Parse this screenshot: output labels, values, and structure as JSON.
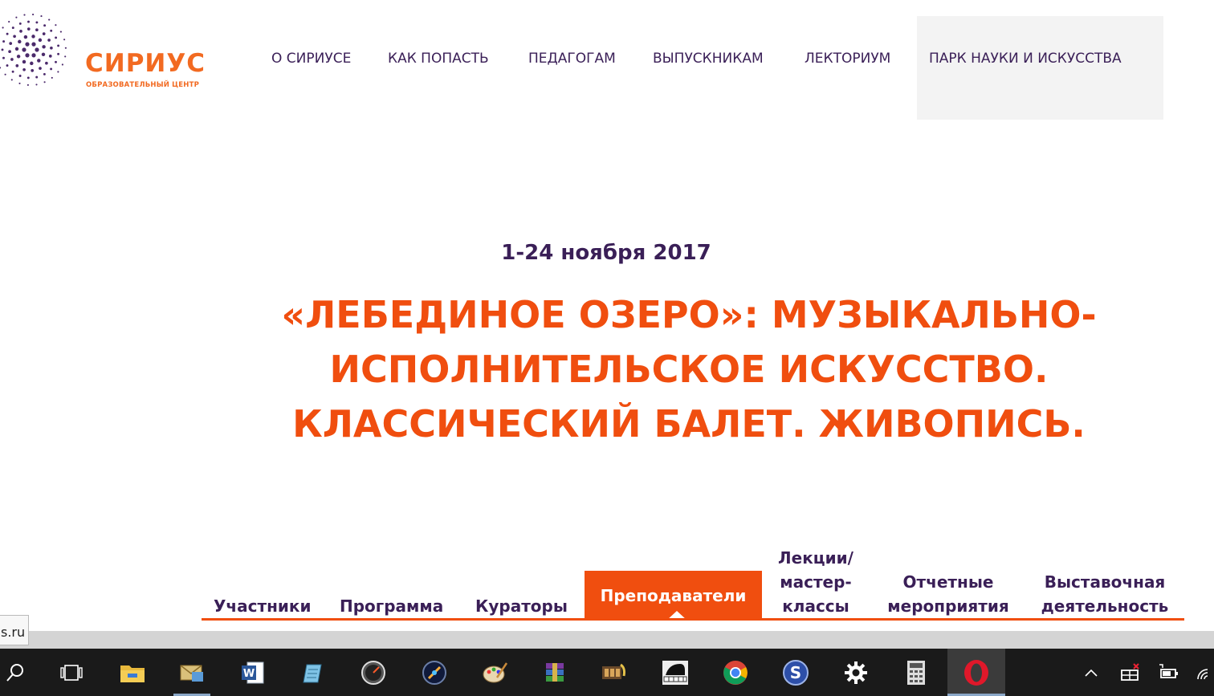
{
  "logo": {
    "name": "СИРИУС",
    "subtitle": "ОБРАЗОВАТЕЛЬНЫЙ ЦЕНТР",
    "color": "#f26a21",
    "dot_color": "#4b2a6b"
  },
  "nav": {
    "items": [
      {
        "label": "О СИРИУСЕ"
      },
      {
        "label": "КАК ПОПАСТЬ"
      },
      {
        "label": "ПЕДАГОГАМ"
      },
      {
        "label": "ВЫПУСКНИКАМ"
      },
      {
        "label": "ЛЕКТОРИУМ"
      },
      {
        "label": "ПАРК НАУКИ И ИСКУССТВА"
      }
    ],
    "highlighted_index": 5
  },
  "hero": {
    "date": "1-24 ноября 2017",
    "title_lines": [
      "«ЛЕБЕДИНОЕ ОЗЕРО»: МУЗЫКАЛЬНО-",
      "ИСПОЛНИТЕЛЬСКОЕ ИСКУССТВО.",
      "КЛАССИЧЕСКИЙ БАЛЕТ. ЖИВОПИСЬ."
    ],
    "accent_color": "#f04e0f",
    "text_color": "#3a1f57"
  },
  "tabs": {
    "items": [
      {
        "lines": [
          "Участники"
        ]
      },
      {
        "lines": [
          "Программа"
        ]
      },
      {
        "lines": [
          "Кураторы"
        ]
      },
      {
        "lines": [
          "Преподаватели"
        ]
      },
      {
        "lines": [
          "Лекции/",
          "мастер-",
          "классы"
        ]
      },
      {
        "lines": [
          "Отчетные",
          "мероприятия"
        ]
      },
      {
        "lines": [
          "Выставочная",
          "деятельность"
        ]
      }
    ],
    "active_index": 3
  },
  "status_bar": {
    "url_fragment": "s.ru"
  },
  "taskbar": {
    "apps": [
      {
        "icon": "search-icon"
      },
      {
        "icon": "task-view-icon"
      },
      {
        "icon": "file-explorer-icon"
      },
      {
        "icon": "mail-icon"
      },
      {
        "icon": "word-icon"
      },
      {
        "icon": "notepad-icon"
      },
      {
        "icon": "speedometer-icon"
      },
      {
        "icon": "media-player-icon"
      },
      {
        "icon": "paint-palette-icon"
      },
      {
        "icon": "winrar-icon"
      },
      {
        "icon": "film-music-icon"
      },
      {
        "icon": "piano-icon"
      },
      {
        "icon": "chrome-icon"
      },
      {
        "icon": "s-app-icon"
      },
      {
        "icon": "settings-gear-icon"
      },
      {
        "icon": "calculator-icon"
      },
      {
        "icon": "opera-icon"
      }
    ],
    "tray": [
      {
        "icon": "chevron-up-icon"
      },
      {
        "icon": "network-x-icon"
      },
      {
        "icon": "battery-plug-icon"
      },
      {
        "icon": "wifi-icon"
      }
    ]
  }
}
